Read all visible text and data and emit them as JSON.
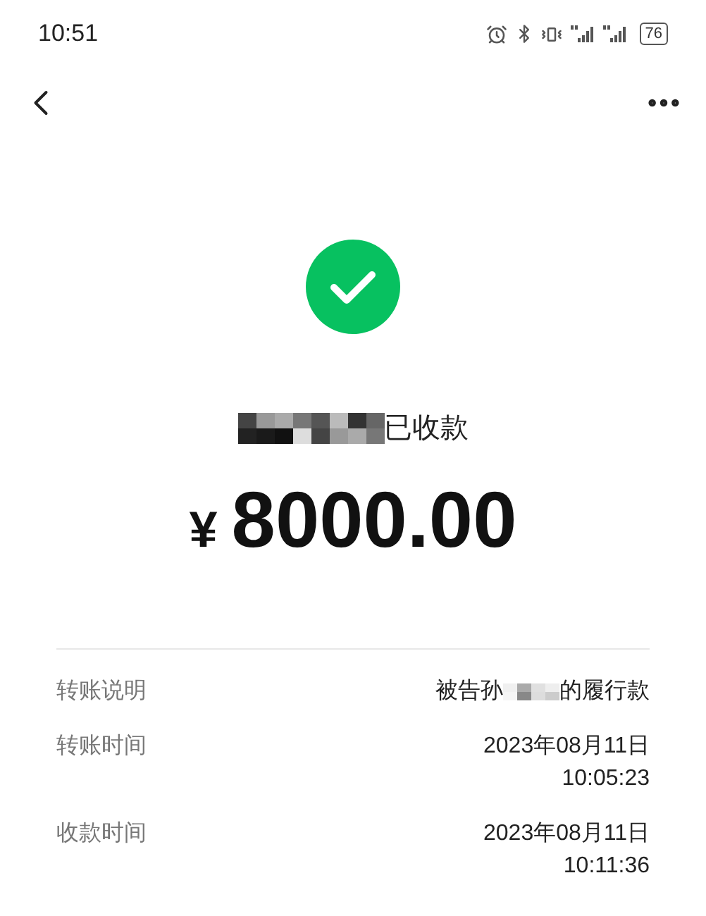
{
  "status_bar": {
    "time": "10:51",
    "battery": "76"
  },
  "payee": {
    "status": "已收款"
  },
  "amount": {
    "currency": "¥",
    "value": "8000.00"
  },
  "details": [
    {
      "label": "转账说明",
      "value_before": "被告孙",
      "value_after": "的履行款",
      "redacted": true
    },
    {
      "label": "转账时间",
      "lines": [
        "2023年08月11日",
        "10:05:23"
      ]
    },
    {
      "label": "收款时间",
      "lines": [
        "2023年08月11日",
        "10:11:36"
      ]
    }
  ]
}
